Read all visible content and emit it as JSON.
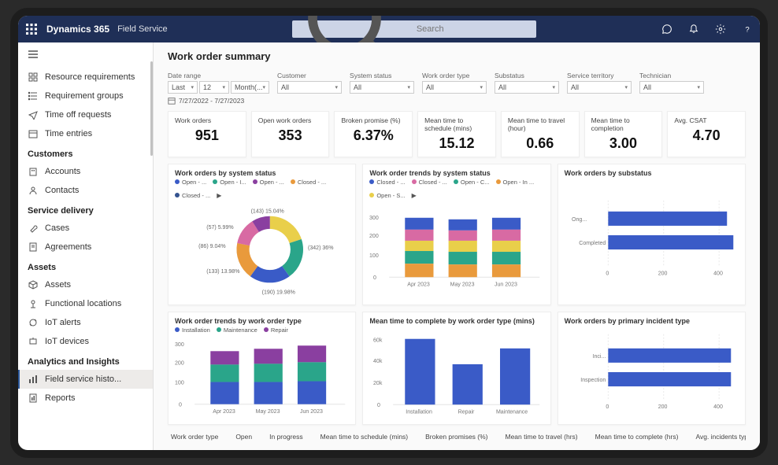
{
  "header": {
    "brand": "Dynamics 365",
    "app": "Field Service",
    "search_placeholder": "Search"
  },
  "sidebar": {
    "top": [
      {
        "label": "Resource requirements",
        "icon": "grid"
      },
      {
        "label": "Requirement groups",
        "icon": "list"
      },
      {
        "label": "Time off requests",
        "icon": "airplane"
      },
      {
        "label": "Time entries",
        "icon": "calendar"
      }
    ],
    "groups": [
      {
        "head": "Customers",
        "items": [
          {
            "label": "Accounts",
            "icon": "building"
          },
          {
            "label": "Contacts",
            "icon": "person"
          }
        ]
      },
      {
        "head": "Service delivery",
        "items": [
          {
            "label": "Cases",
            "icon": "wrench"
          },
          {
            "label": "Agreements",
            "icon": "doc"
          }
        ]
      },
      {
        "head": "Assets",
        "items": [
          {
            "label": "Assets",
            "icon": "cube"
          },
          {
            "label": "Functional locations",
            "icon": "location"
          },
          {
            "label": "IoT alerts",
            "icon": "alert"
          },
          {
            "label": "IoT devices",
            "icon": "device"
          }
        ]
      },
      {
        "head": "Analytics and Insights",
        "items": [
          {
            "label": "Field service histo...",
            "icon": "chart",
            "active": true
          },
          {
            "label": "Reports",
            "icon": "report"
          }
        ]
      }
    ]
  },
  "page": {
    "title": "Work order summary",
    "filters": {
      "date_label": "Date range",
      "date_v1": "Last",
      "date_v2": "12",
      "date_v3": "Month(...",
      "range_text": "7/27/2022 - 7/27/2023",
      "cols": [
        {
          "label": "Customer",
          "value": "All"
        },
        {
          "label": "System status",
          "value": "All"
        },
        {
          "label": "Work order type",
          "value": "All"
        },
        {
          "label": "Substatus",
          "value": "All"
        },
        {
          "label": "Service territory",
          "value": "All"
        },
        {
          "label": "Technician",
          "value": "All"
        }
      ]
    },
    "kpis": [
      {
        "label": "Work orders",
        "value": "951"
      },
      {
        "label": "Open work orders",
        "value": "353"
      },
      {
        "label": "Broken promise (%)",
        "value": "6.37%"
      },
      {
        "label": "Mean time to schedule (mins)",
        "value": "15.12"
      },
      {
        "label": "Mean time to travel (hour)",
        "value": "0.66"
      },
      {
        "label": "Mean time to completion",
        "value": "3.00"
      },
      {
        "label": "Avg. CSAT",
        "value": "4.70"
      }
    ],
    "chart_titles": {
      "c1": "Work orders by system status",
      "c2": "Work order trends by system status",
      "c3": "Work orders by substatus",
      "c4": "Work order trends by work order type",
      "c5": "Mean time to complete by work order type (mins)",
      "c6": "Work orders by primary incident type"
    },
    "legends": {
      "c1": [
        "Open - ...",
        "Open - I...",
        "Open - ...",
        "Closed - ...",
        "Closed - ..."
      ],
      "c2": [
        "Closed - ...",
        "Closed - ...",
        "Open - C...",
        "Open - In ...",
        "Open - S..."
      ],
      "c4": [
        "Installation",
        "Maintenance",
        "Repair"
      ]
    },
    "axis": {
      "months": [
        "Apr 2023",
        "May 2023",
        "Jun 2023"
      ],
      "c3_cats": [
        "Ong...",
        "Completed"
      ],
      "c3_ticks": [
        "0",
        "200",
        "400"
      ],
      "c5_cats": [
        "Installation",
        "Repair",
        "Maintenance"
      ],
      "c5_ticks": [
        "0",
        "20k",
        "40k",
        "60k"
      ],
      "c6_cats": [
        "Inci...",
        "Inspection"
      ],
      "c6_ticks": [
        "0",
        "200",
        "400"
      ],
      "c2_ticks": [
        "0",
        "100",
        "200",
        "300"
      ],
      "c4_ticks": [
        "0",
        "100",
        "200",
        "300"
      ]
    },
    "donut_labels": {
      "a": "(143) 15.04%",
      "b": "(57) 5.99%",
      "c": "(86) 9.04%",
      "d": "(133) 13.98%",
      "e": "(190) 19.98%",
      "f": "(342) 36%"
    },
    "bottom": [
      "Work order type",
      "Open",
      "In progress",
      "Mean time to schedule (mins)",
      "Broken promises (%)",
      "Mean time to travel (hrs)",
      "Mean time to complete (hrs)",
      "Avg. incidents types"
    ]
  },
  "colors": {
    "blue": "#3a5bc7",
    "teal": "#2aa58a",
    "purple": "#8a3fa0",
    "orange": "#e99a3c",
    "yellow": "#e9cf4a",
    "pink": "#d86aa3",
    "green": "#45b26b",
    "navy": "#34538f"
  },
  "chart_data": [
    {
      "id": "c1",
      "type": "pie",
      "title": "Work orders by system status",
      "series": [
        {
          "name": "Open - ...",
          "value": 143,
          "pct": 15.04
        },
        {
          "name": "Open - I...",
          "value": 57,
          "pct": 5.99
        },
        {
          "name": "Open - ...",
          "value": 86,
          "pct": 9.04
        },
        {
          "name": "Closed - ...",
          "value": 133,
          "pct": 13.98
        },
        {
          "name": "Closed - ...",
          "value": 190,
          "pct": 19.98
        },
        {
          "name": "(342)",
          "value": 342,
          "pct": 36.0
        }
      ]
    },
    {
      "id": "c2",
      "type": "bar",
      "title": "Work order trends by system status",
      "categories": [
        "Apr 2023",
        "May 2023",
        "Jun 2023"
      ],
      "series": [
        {
          "name": "Closed - ...",
          "values": [
            60,
            58,
            60
          ]
        },
        {
          "name": "Closed - ...",
          "values": [
            52,
            50,
            52
          ]
        },
        {
          "name": "Open - C...",
          "values": [
            48,
            52,
            50
          ]
        },
        {
          "name": "Open - In ...",
          "values": [
            60,
            58,
            60
          ]
        },
        {
          "name": "Open - S...",
          "values": [
            55,
            57,
            55
          ]
        }
      ],
      "ylim": [
        0,
        300
      ]
    },
    {
      "id": "c3",
      "type": "bar",
      "title": "Work orders by substatus",
      "orientation": "horizontal",
      "categories": [
        "Ongoing",
        "Completed"
      ],
      "values": [
        420,
        440
      ],
      "xlim": [
        0,
        450
      ]
    },
    {
      "id": "c4",
      "type": "bar",
      "title": "Work order trends by work order type",
      "categories": [
        "Apr 2023",
        "May 2023",
        "Jun 2023"
      ],
      "series": [
        {
          "name": "Installation",
          "values": [
            120,
            120,
            125
          ]
        },
        {
          "name": "Maintenance",
          "values": [
            95,
            100,
            100
          ]
        },
        {
          "name": "Repair",
          "values": [
            70,
            80,
            90
          ]
        }
      ],
      "ylim": [
        0,
        300
      ]
    },
    {
      "id": "c5",
      "type": "bar",
      "title": "Mean time to complete by work order type (mins)",
      "categories": [
        "Installation",
        "Repair",
        "Maintenance"
      ],
      "values": [
        58000,
        36000,
        50000
      ],
      "ylim": [
        0,
        60000
      ]
    },
    {
      "id": "c6",
      "type": "bar",
      "title": "Work orders by primary incident type",
      "orientation": "horizontal",
      "categories": [
        "Incident",
        "Inspection"
      ],
      "values": [
        430,
        430
      ],
      "xlim": [
        0,
        450
      ]
    }
  ]
}
